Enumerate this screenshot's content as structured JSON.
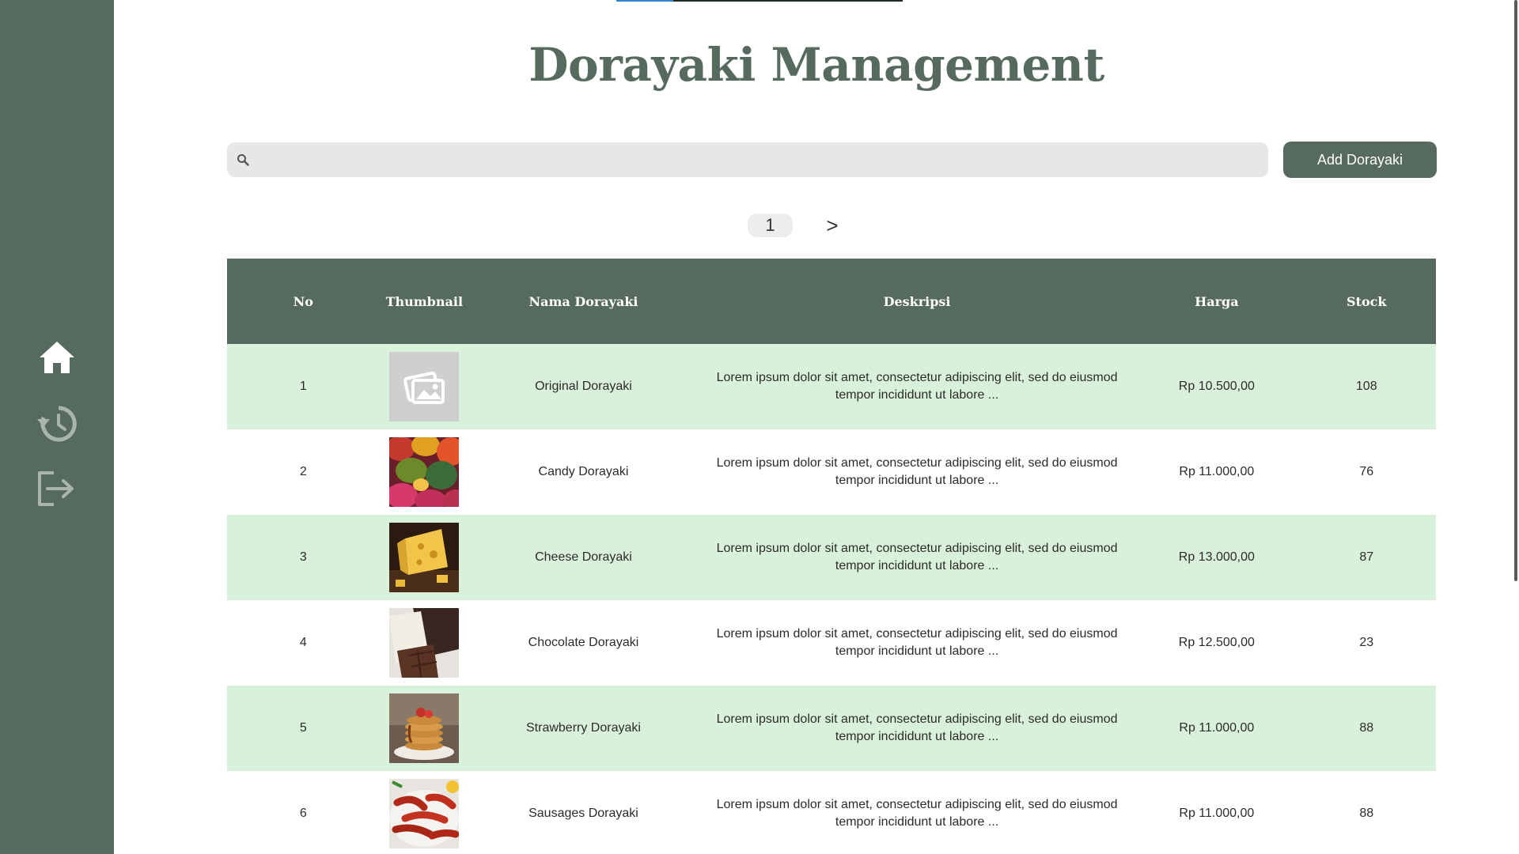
{
  "page": {
    "title": "Dorayaki Management"
  },
  "sidebar": {
    "items": [
      {
        "icon": "home-icon",
        "label": "Home"
      },
      {
        "icon": "history-icon",
        "label": "History"
      },
      {
        "icon": "logout-icon",
        "label": "Logout"
      }
    ]
  },
  "search": {
    "placeholder": "",
    "value": ""
  },
  "toolbar": {
    "add_label": "Add Dorayaki"
  },
  "pagination": {
    "current": "1",
    "next": ">"
  },
  "table": {
    "columns": [
      "No",
      "Thumbnail",
      "Nama Dorayaki",
      "Deskripsi",
      "Harga",
      "Stock"
    ],
    "rows": [
      {
        "no": "1",
        "thumbnail": "placeholder-image",
        "name": "Original Dorayaki",
        "desc": "Lorem ipsum dolor sit amet, consectetur adipiscing elit, sed do eiusmod tempor incididunt ut labore ...",
        "price": "Rp 10.500,00",
        "stock": "108"
      },
      {
        "no": "2",
        "thumbnail": "candy-photo",
        "name": "Candy Dorayaki",
        "desc": "Lorem ipsum dolor sit amet, consectetur adipiscing elit, sed do eiusmod tempor incididunt ut labore ...",
        "price": "Rp 11.000,00",
        "stock": "76"
      },
      {
        "no": "3",
        "thumbnail": "cheese-photo",
        "name": "Cheese Dorayaki",
        "desc": "Lorem ipsum dolor sit amet, consectetur adipiscing elit, sed do eiusmod tempor incididunt ut labore ...",
        "price": "Rp 13.000,00",
        "stock": "87"
      },
      {
        "no": "4",
        "thumbnail": "chocolate-photo",
        "name": "Chocolate Dorayaki",
        "desc": "Lorem ipsum dolor sit amet, consectetur adipiscing elit, sed do eiusmod tempor incididunt ut labore ...",
        "price": "Rp 12.500,00",
        "stock": "23"
      },
      {
        "no": "5",
        "thumbnail": "strawberry-pancake-photo",
        "name": "Strawberry Dorayaki",
        "desc": "Lorem ipsum dolor sit amet, consectetur adipiscing elit, sed do eiusmod tempor incididunt ut labore ...",
        "price": "Rp 11.000,00",
        "stock": "88"
      },
      {
        "no": "6",
        "thumbnail": "sausages-photo",
        "name": "Sausages Dorayaki",
        "desc": "Lorem ipsum dolor sit amet, consectetur adipiscing elit, sed do eiusmod tempor incididunt ut labore ...",
        "price": "Rp 11.000,00",
        "stock": "88"
      }
    ]
  },
  "colors": {
    "sidebar": "#566b5d",
    "accent": "#566b5d",
    "row_highlight": "#d9f1da",
    "search_bg": "#e7e7e7",
    "loader": "#2f86d6"
  }
}
